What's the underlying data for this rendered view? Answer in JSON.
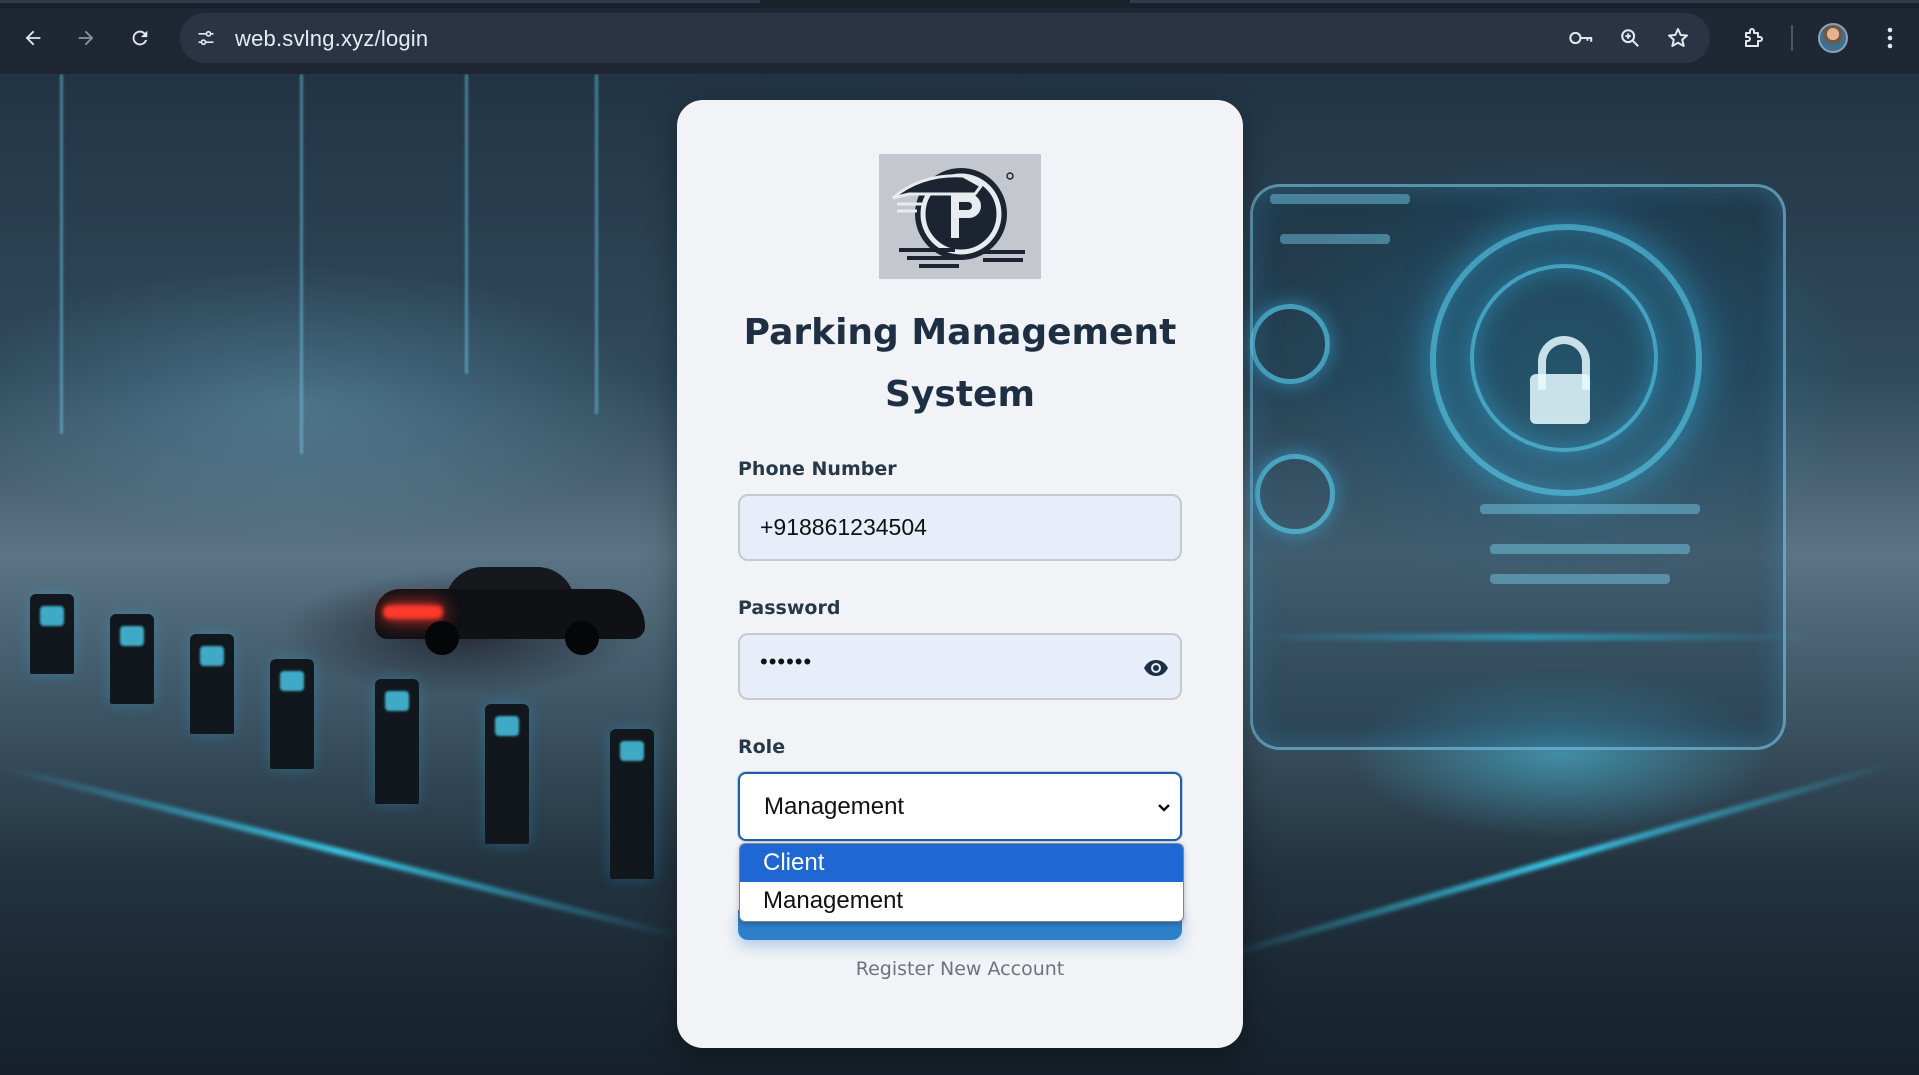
{
  "browser": {
    "url": "web.svlng.xyz/login",
    "icons": {
      "back": "arrow-left-icon",
      "forward": "arrow-right-icon",
      "reload": "reload-icon",
      "site_info": "tune-icon",
      "password_manager": "key-icon",
      "zoom": "zoom-icon",
      "bookmark": "star-icon",
      "extensions": "puzzle-icon",
      "menu": "kebab-menu-icon"
    }
  },
  "login": {
    "title_line1": "Parking Management",
    "title_line2": "System",
    "phone_label": "Phone Number",
    "phone_value": "+918861234504",
    "password_label": "Password",
    "password_value": "••••••",
    "role_label": "Role",
    "role_selected": "Management",
    "role_options": [
      "Client",
      "Management"
    ],
    "highlighted_option": "Client",
    "register_link": "Register New Account"
  },
  "colors": {
    "card_bg": "#f1f3f6",
    "title": "#1e2f43",
    "input_bg": "#e8eef9",
    "accent": "#2d7fc9",
    "option_highlight": "#1f67d2"
  }
}
